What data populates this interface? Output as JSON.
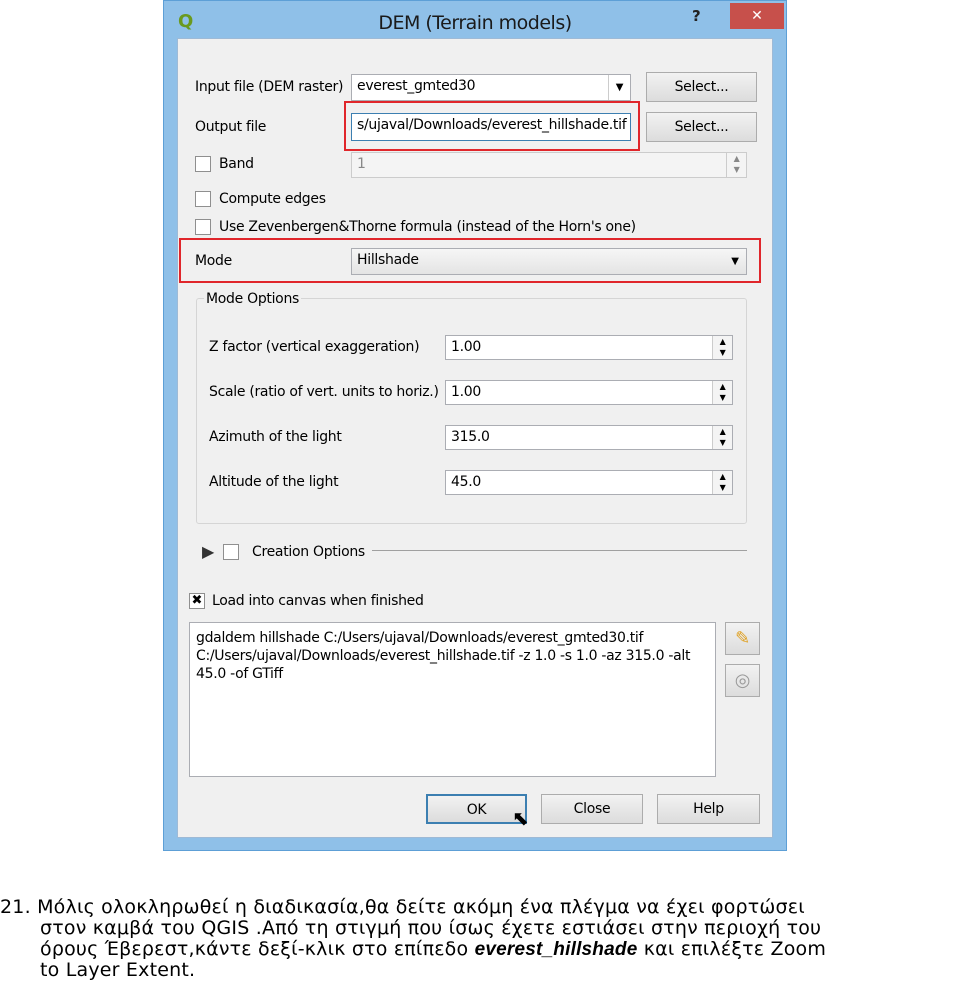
{
  "dialog": {
    "title": "DEM (Terrain models)",
    "help": "?",
    "close": "✕",
    "input_label": "Input file (DEM raster)",
    "input_value": "everest_gmted30",
    "select1": "Select...",
    "output_label": "Output file",
    "output_value": "s/ujaval/Downloads/everest_hillshade.tif",
    "select2": "Select...",
    "band_label": "Band",
    "band_value": "1",
    "band_checked": false,
    "compute_edges": "Compute edges",
    "zevenbergen": "Use Zevenbergen&Thorne formula (instead of the Horn's one)",
    "mode_label": "Mode",
    "mode_value": "Hillshade",
    "mode_options": {
      "title": "Mode Options",
      "fields": [
        {
          "label": "Z factor (vertical exaggeration)",
          "value": "1.00"
        },
        {
          "label": "Scale (ratio of vert. units to horiz.)",
          "value": "1.00"
        },
        {
          "label": "Azimuth of the light",
          "value": "315.0"
        },
        {
          "label": "Altitude of the light",
          "value": "45.0"
        }
      ]
    },
    "creation_options": "Creation Options",
    "load_canvas": "Load into canvas when finished",
    "load_checked": true,
    "command": "gdaldem hillshade C:/Users/ujaval/Downloads/everest_gmted30.tif\nC:/Users/ujaval/Downloads/everest_hillshade.tif -z 1.0 -s 1.0 -az 315.0 -alt\n45.0 -of GTiff",
    "ok": "OK",
    "close_btn": "Close",
    "help_btn": "Help",
    "highlight_color": "#e0262b"
  },
  "text": {
    "number": "21.",
    "line1": "Μόλις ολοκληρωθεί η διαδικασία,θα δείτε ακόμη ένα πλέγμα να έχει φορτώσει",
    "line2": "στον καμβά του QGIS .Από τη στιγμή που ίσως έχετε εστιάσει στην περιοχή του",
    "line3a": "όρους Έβερεστ,κάντε δεξί-κλικ στο επίπεδο ",
    "line3b": "everest_hillshade",
    "line3c": " και επιλέξτε Zoom",
    "line4": "to Layer Extent."
  }
}
